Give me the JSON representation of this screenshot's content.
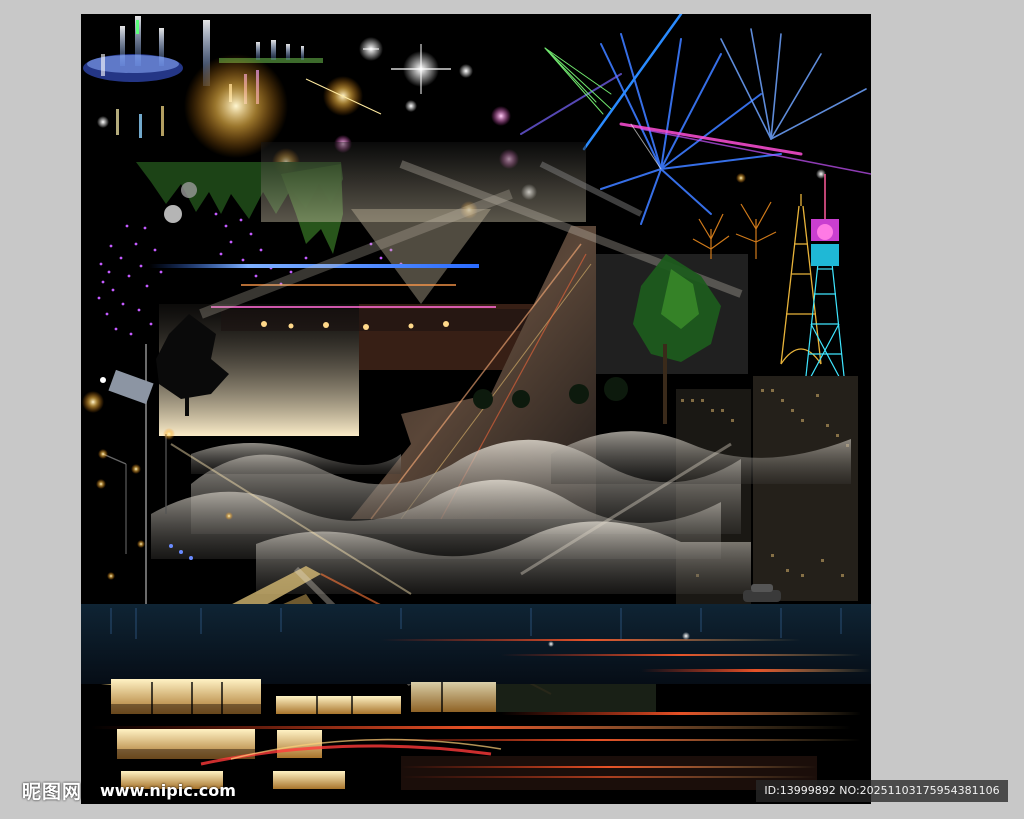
{
  "watermark": {
    "logo_text": "昵图网",
    "site": "www.nipic.com",
    "id_line": "ID:13999892 NO:20251103175954381106"
  },
  "colors": {
    "page_background": "#c8c8c8",
    "canvas_background": "#000000",
    "laser_blue": "#3c7bff",
    "laser_pink": "#ff4fd8",
    "laser_green": "#7dff7a",
    "tower_cyan": "#3fe6ff",
    "tower_gold": "#e8b33a",
    "wave_gray": "#b9b3a8",
    "warm_light": "#ffd98a"
  },
  "scene": {
    "fountains": 2,
    "street_lamps": 6,
    "trees": 3,
    "towers": 2
  }
}
